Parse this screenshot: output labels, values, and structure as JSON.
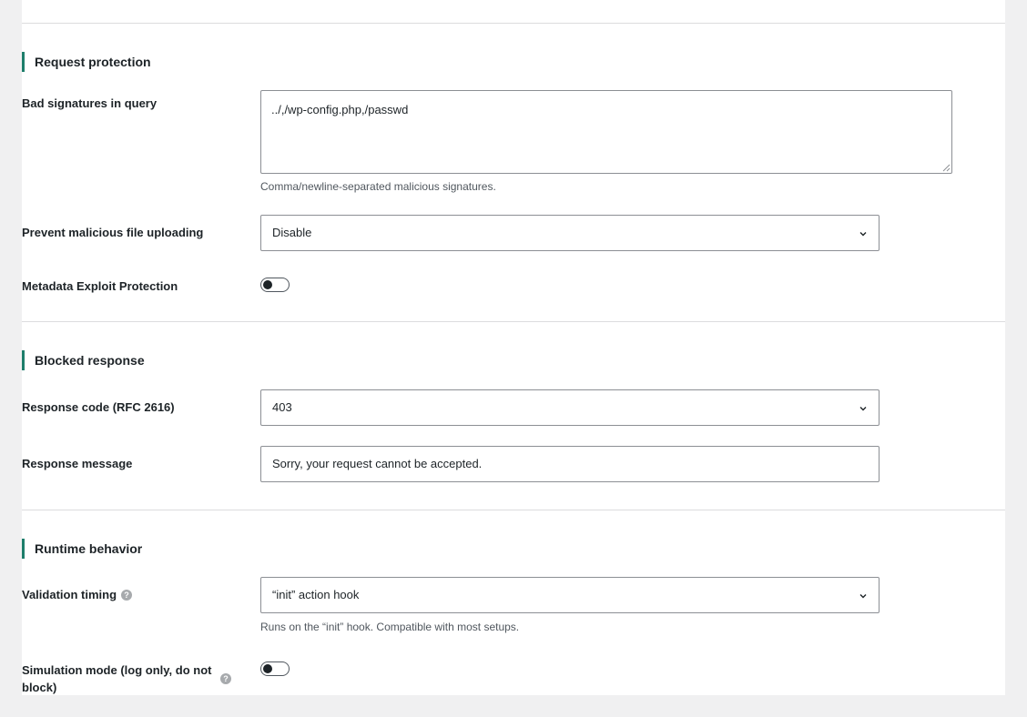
{
  "request_protection": {
    "title": "Request protection",
    "bad_signatures": {
      "label": "Bad signatures in query",
      "value": "../,/wp-config.php,/passwd",
      "description": "Comma/newline-separated malicious signatures."
    },
    "file_upload": {
      "label": "Prevent malicious file uploading",
      "selected": "Disable"
    },
    "metadata_exploit": {
      "label": "Metadata Exploit Protection",
      "enabled": false
    }
  },
  "blocked_response": {
    "title": "Blocked response",
    "response_code": {
      "label": "Response code (RFC 2616)",
      "selected": "403"
    },
    "response_message": {
      "label": "Response message",
      "value": "Sorry, your request cannot be accepted."
    }
  },
  "runtime_behavior": {
    "title": "Runtime behavior",
    "validation_timing": {
      "label": "Validation timing",
      "selected": "“init” action hook",
      "description": "Runs on the “init” hook. Compatible with most setups."
    },
    "simulation_mode": {
      "label": "Simulation mode (log only, do not block)",
      "enabled": false
    }
  },
  "icons": {
    "help": "question-circle-icon",
    "chevron": "chevron-down-icon",
    "help_glyph": "?"
  },
  "colors": {
    "accent": "#1e7e6b",
    "page_background": "#f0f0f1",
    "panel_background": "#ffffff",
    "border": "#8c8f94"
  }
}
